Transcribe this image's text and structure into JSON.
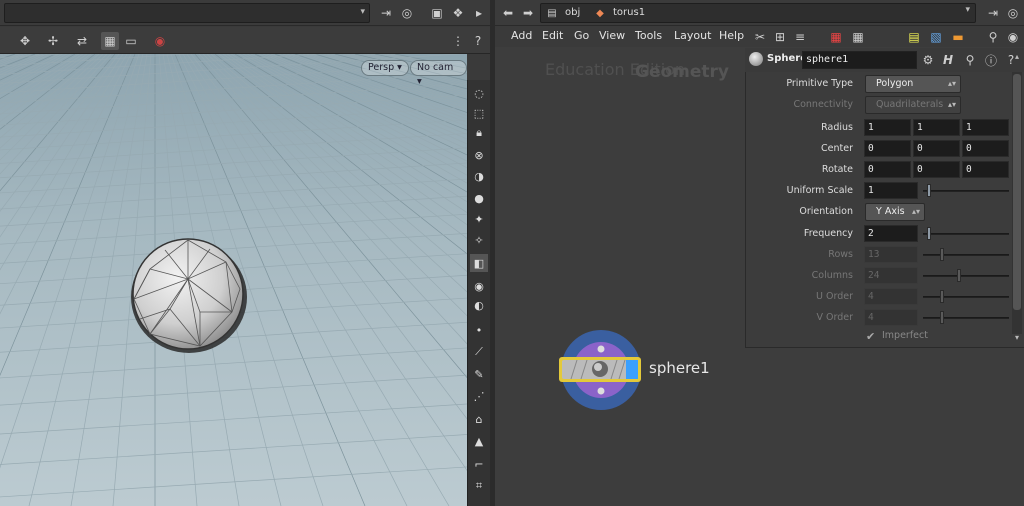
{
  "left_panel": {
    "viewport_buttons": {
      "persp": "Persp",
      "camera": "No cam"
    }
  },
  "right_panel": {
    "path": {
      "root": "obj",
      "node": "torus1"
    },
    "menus": [
      "Add",
      "Edit",
      "Go",
      "View",
      "Tools",
      "Layout",
      "Help"
    ],
    "watermark": {
      "edition": "Education Edition",
      "context": "Geometry"
    }
  },
  "params": {
    "node_type": "Sphere",
    "node_name": "sphere1",
    "rows": [
      {
        "label": "Primitive Type",
        "kind": "menu",
        "value": "Polygon",
        "enabled": true
      },
      {
        "label": "Connectivity",
        "kind": "menu",
        "value": "Quadrilaterals",
        "enabled": false
      },
      {
        "label": "Radius",
        "kind": "vec",
        "values": [
          "1",
          "1",
          "1"
        ],
        "enabled": true
      },
      {
        "label": "Center",
        "kind": "vec",
        "values": [
          "0",
          "0",
          "0"
        ],
        "enabled": true
      },
      {
        "label": "Rotate",
        "kind": "vec",
        "values": [
          "0",
          "0",
          "0"
        ],
        "enabled": true
      },
      {
        "label": "Uniform Scale",
        "kind": "slider",
        "value": "1",
        "slider_fraction": 0.05,
        "enabled": true
      },
      {
        "label": "Orientation",
        "kind": "menu-small",
        "value": "Y Axis",
        "enabled": true
      },
      {
        "label": "Frequency",
        "kind": "slider",
        "value": "2",
        "slider_fraction": 0.05,
        "enabled": true
      },
      {
        "label": "Rows",
        "kind": "slider",
        "value": "13",
        "slider_fraction": 0.2,
        "enabled": false
      },
      {
        "label": "Columns",
        "kind": "slider",
        "value": "24",
        "slider_fraction": 0.4,
        "enabled": false
      },
      {
        "label": "U Order",
        "kind": "slider",
        "value": "4",
        "slider_fraction": 0.2,
        "enabled": false
      },
      {
        "label": "V Order",
        "kind": "slider",
        "value": "4",
        "slider_fraction": 0.2,
        "enabled": false
      }
    ],
    "imperfect": {
      "label": "Imperfect",
      "checked": true
    }
  },
  "node": {
    "name": "sphere1"
  },
  "colors": {
    "accent": "#3aa0ff",
    "node_ring": "#3a5fa0",
    "node_inner": "#8b63c9",
    "node_flag": "#e3c93a"
  }
}
